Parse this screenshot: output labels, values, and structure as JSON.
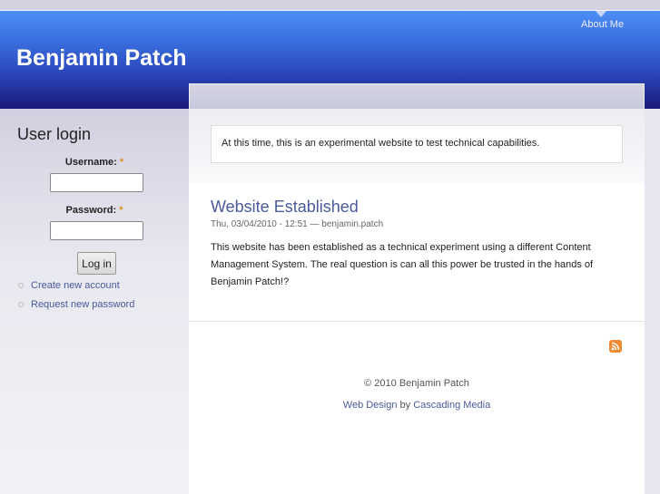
{
  "header": {
    "site_title": "Benjamin Patch",
    "nav": [
      {
        "label": "About Me"
      }
    ]
  },
  "sidebar": {
    "title": "User login",
    "username_label": "Username:",
    "password_label": "Password:",
    "required_mark": "*",
    "username_value": "",
    "password_value": "",
    "login_button": "Log in",
    "links": [
      "Create new account",
      "Request new password"
    ]
  },
  "main": {
    "notice": "At this time, this is an experimental website to test technical capabilities.",
    "post": {
      "title": "Website Established",
      "meta": "Thu, 03/04/2010 - 12:51 — benjamin.patch",
      "body": "This website has been established as a technical experiment using a different Content Management System. The real question is can all this power be trusted in the hands of Benjamin Patch!?"
    }
  },
  "footer": {
    "copyright": "© 2010 Benjamin Patch",
    "credit_link1": "Web Design",
    "credit_by": " by ",
    "credit_link2": "Cascading Media"
  },
  "icons": {
    "rss": "rss-feed-icon"
  },
  "colors": {
    "header_top": "#4d8ff5",
    "header_bottom": "#1a1a7a",
    "link": "#4a5a9a",
    "rss": "#f08a30"
  }
}
